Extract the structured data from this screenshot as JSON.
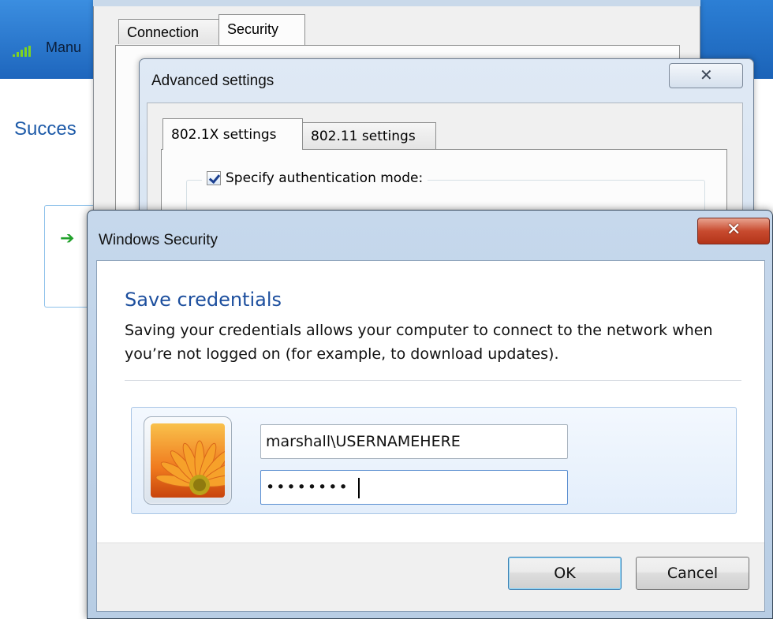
{
  "background_wizard": {
    "network_label": "Manu",
    "status_heading": "Succes"
  },
  "properties_window": {
    "tabs": [
      {
        "label": "Connection",
        "selected": false
      },
      {
        "label": "Security",
        "selected": true
      }
    ]
  },
  "advanced_settings": {
    "title": "Advanced settings",
    "close_icon": "close-icon",
    "tabs": [
      {
        "label": "802.1X settings",
        "selected": true
      },
      {
        "label": "802.11 settings",
        "selected": false
      }
    ],
    "specify_auth_mode": {
      "label": "Specify authentication mode:",
      "checked": true
    }
  },
  "windows_security": {
    "title": "Windows Security",
    "close_icon": "close-icon",
    "heading": "Save credentials",
    "description": "Saving your credentials allows your computer to connect to the network when you’re not logged on (for example, to download updates).",
    "username_value": "marshall\\USERNAMEHERE",
    "password_masked": "••••••••",
    "ok_label": "OK",
    "cancel_label": "Cancel",
    "colors": {
      "heading_blue": "#1d4f9e",
      "close_red": "#c84b2f",
      "panel_blue": "#e3eefb"
    }
  }
}
